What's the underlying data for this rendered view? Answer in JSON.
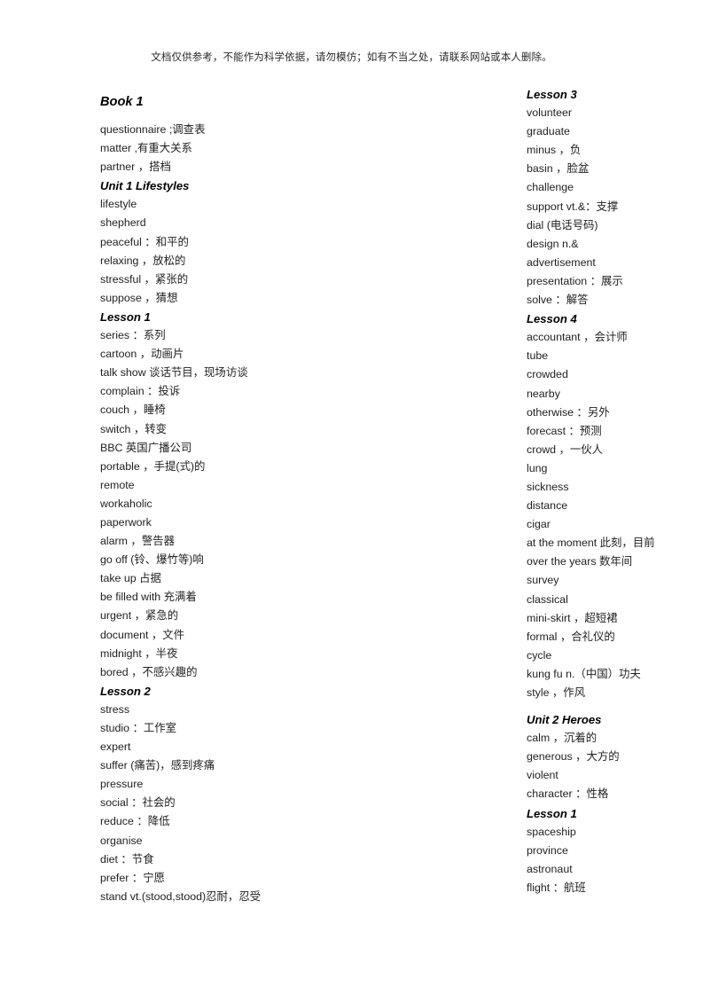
{
  "disclaimer": "文档仅供参考，不能作为科学依据，请勿模仿；如有不当之处，请联系网站或本人删除。",
  "colors": {
    "page_background": "#ffffff",
    "body_text": "#1f1f1f",
    "heading_text": "#000000",
    "disclaimer_text": "#2b2b2b"
  },
  "left_column": [
    {
      "type": "booktitle",
      "text": "Book 1"
    },
    {
      "type": "gap"
    },
    {
      "type": "entry",
      "text": "questionnaire   ;调查表"
    },
    {
      "type": "entry",
      "text": "matter   ,有重大关系"
    },
    {
      "type": "entry",
      "text": "partner   ，搭档"
    },
    {
      "type": "heading",
      "text": "Unit 1 Lifestyles"
    },
    {
      "type": "entry",
      "text": "lifestyle"
    },
    {
      "type": "entry",
      "text": "shepherd"
    },
    {
      "type": "entry",
      "text": "peaceful   ：和平的"
    },
    {
      "type": "entry",
      "text": "relaxing   ，放松的"
    },
    {
      "type": "entry",
      "text": "stressful   ，紧张的"
    },
    {
      "type": "entry",
      "text": "suppose   ，猜想"
    },
    {
      "type": "heading",
      "text": "Lesson 1"
    },
    {
      "type": "entry",
      "text": "series   ：系列"
    },
    {
      "type": "entry",
      "text": "cartoon   ，动画片"
    },
    {
      "type": "entry",
      "text": "talk show  谈话节目，现场访谈"
    },
    {
      "type": "entry",
      "text": "complain   ：投诉"
    },
    {
      "type": "entry",
      "text": "couch   ，睡椅"
    },
    {
      "type": "entry",
      "text": "switch   ，转变"
    },
    {
      "type": "entry",
      "text": "BBC   英国广播公司"
    },
    {
      "type": "entry",
      "text": "portable   ，手提(式)的"
    },
    {
      "type": "entry",
      "text": "remote"
    },
    {
      "type": "entry",
      "text": "workaholic"
    },
    {
      "type": "entry",
      "text": "paperwork"
    },
    {
      "type": "entry",
      "text": "alarm   ，警告器"
    },
    {
      "type": "entry",
      "text": "go off   (铃、爆竹等)响"
    },
    {
      "type": "entry",
      "text": "take up   占据"
    },
    {
      "type": "entry",
      "text": "be filled with   充满着"
    },
    {
      "type": "entry",
      "text": "urgent   ，紧急的"
    },
    {
      "type": "entry",
      "text": "document   ，文件"
    },
    {
      "type": "entry",
      "text": "midnight   ，半夜"
    },
    {
      "type": "entry",
      "text": "bored   ，不感兴趣的"
    },
    {
      "type": "heading",
      "text": "Lesson 2"
    },
    {
      "type": "entry",
      "text": "stress"
    },
    {
      "type": "entry",
      "text": "studio   ：工作室"
    },
    {
      "type": "entry",
      "text": "expert"
    },
    {
      "type": "entry",
      "text": "suffer   (痛苦)，感到疼痛"
    },
    {
      "type": "entry",
      "text": "pressure"
    },
    {
      "type": "entry",
      "text": "social   ：社会的"
    },
    {
      "type": "entry",
      "text": "reduce   ：降低"
    },
    {
      "type": "entry",
      "text": "organise"
    },
    {
      "type": "entry",
      "text": "diet   ：节食"
    },
    {
      "type": "entry",
      "text": "prefer   ：宁愿"
    },
    {
      "type": "entry",
      "text": "stand   vt.(stood,stood)忍耐，忍受"
    }
  ],
  "right_column": [
    {
      "type": "heading",
      "text": "Lesson 3"
    },
    {
      "type": "entry",
      "text": "volunteer"
    },
    {
      "type": "entry",
      "text": "graduate"
    },
    {
      "type": "entry",
      "text": "minus   ，负"
    },
    {
      "type": "entry",
      "text": "basin   ，脸盆"
    },
    {
      "type": "entry",
      "text": "challenge"
    },
    {
      "type": "entry",
      "text": "support   vt.&：支撑"
    },
    {
      "type": "entry",
      "text": "dial   (电话号码)"
    },
    {
      "type": "entry",
      "text": "design   n.&"
    },
    {
      "type": "entry",
      "text": "advertisement"
    },
    {
      "type": "entry",
      "text": "presentation   ：展示"
    },
    {
      "type": "entry",
      "text": "solve   ：解答"
    },
    {
      "type": "heading",
      "text": "Lesson 4"
    },
    {
      "type": "entry",
      "text": "accountant   ，会计师"
    },
    {
      "type": "entry",
      "text": "tube"
    },
    {
      "type": "entry",
      "text": "crowded"
    },
    {
      "type": "entry",
      "text": "nearby"
    },
    {
      "type": "entry",
      "text": "otherwise   ：另外"
    },
    {
      "type": "entry",
      "text": "forecast   ：预测"
    },
    {
      "type": "entry",
      "text": "crowd   ，一伙人"
    },
    {
      "type": "entry",
      "text": "lung"
    },
    {
      "type": "entry",
      "text": "sickness"
    },
    {
      "type": "entry",
      "text": "distance"
    },
    {
      "type": "entry",
      "text": "cigar"
    },
    {
      "type": "entry",
      "text": "at the moment   此刻，目前"
    },
    {
      "type": "entry",
      "text": "over the years   数年间"
    },
    {
      "type": "entry",
      "text": "survey"
    },
    {
      "type": "entry",
      "text": "classical"
    },
    {
      "type": "entry",
      "text": "mini-skirt   ，超短裙"
    },
    {
      "type": "entry",
      "text": "formal   ，合礼仪的"
    },
    {
      "type": "entry",
      "text": "cycle"
    },
    {
      "type": "entry",
      "text": "kung fu   n.（中国）功夫"
    },
    {
      "type": "entry",
      "text": "style   ，作风"
    },
    {
      "type": "gap"
    },
    {
      "type": "heading",
      "text": "Unit 2 Heroes"
    },
    {
      "type": "entry",
      "text": "calm   ，沉着的"
    },
    {
      "type": "entry",
      "text": "generous   ，大方的"
    },
    {
      "type": "entry",
      "text": "violent"
    },
    {
      "type": "entry",
      "text": "character   ：性格"
    },
    {
      "type": "heading",
      "text": "Lesson 1"
    },
    {
      "type": "entry",
      "text": "spaceship"
    },
    {
      "type": "entry",
      "text": "province"
    },
    {
      "type": "entry",
      "text": "astronaut"
    },
    {
      "type": "entry",
      "text": "flight   ：航班"
    }
  ]
}
